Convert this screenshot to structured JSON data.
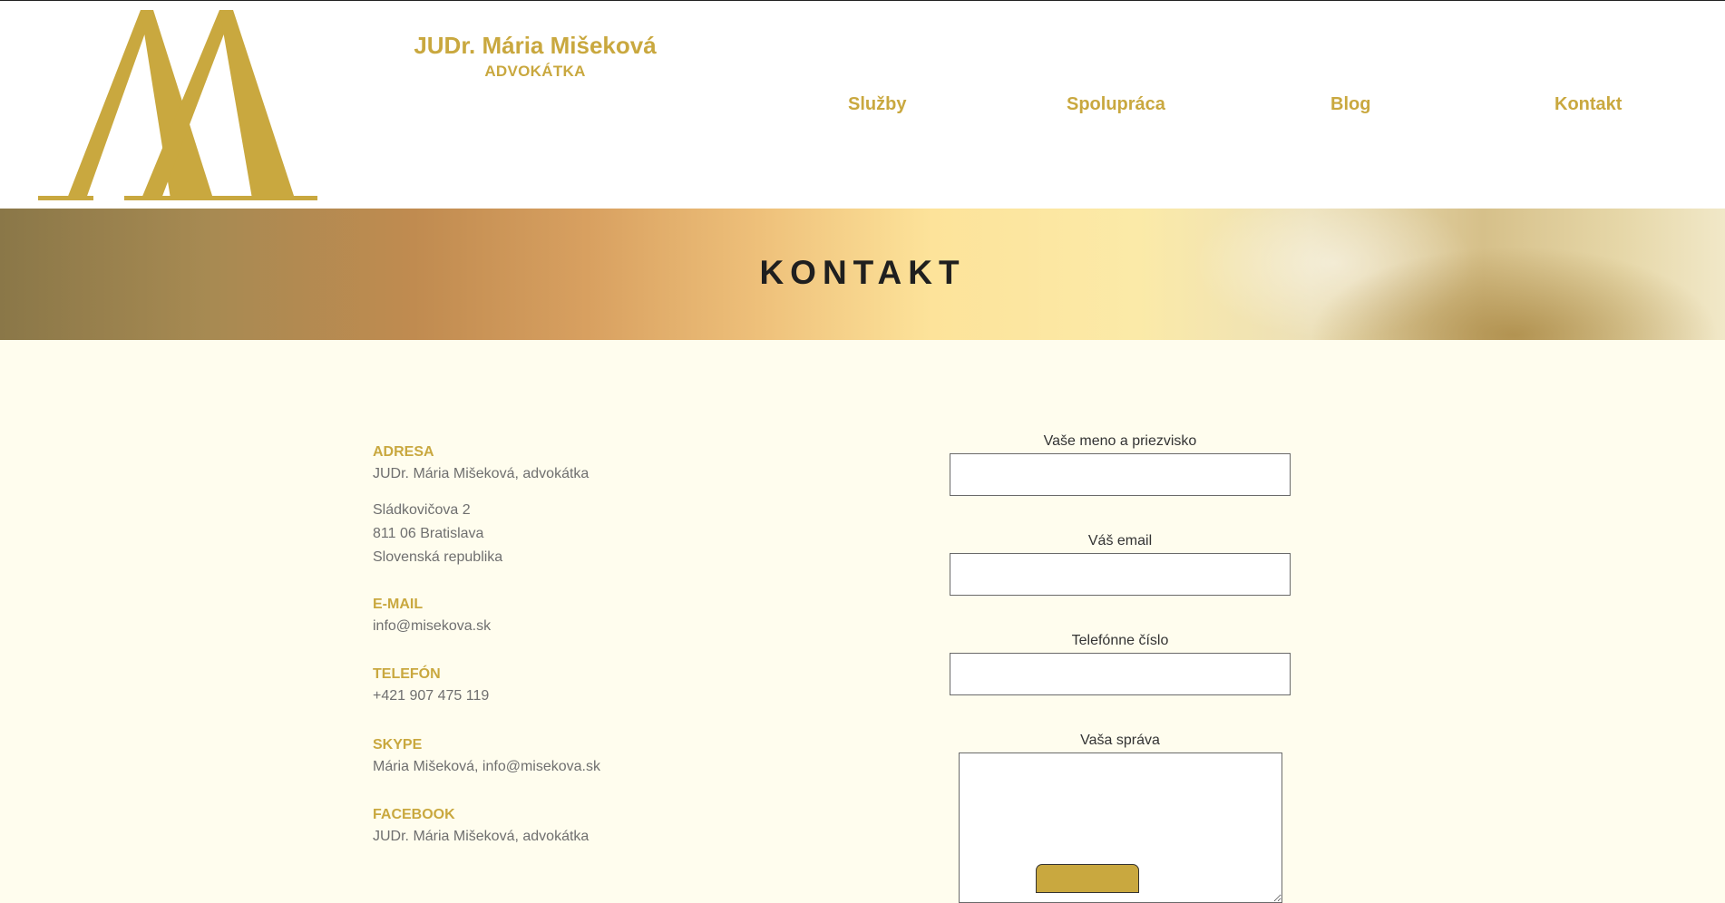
{
  "brand": {
    "name": "JUDr. Mária Mišeková",
    "subtitle": "ADVOKÁTKA",
    "logo_icon": "double-a-monogram-logo",
    "color": "#c9a83f"
  },
  "nav": {
    "items": [
      {
        "label": "Služby"
      },
      {
        "label": "Spolupráca"
      },
      {
        "label": "Blog"
      },
      {
        "label": "Kontakt"
      }
    ]
  },
  "banner": {
    "title": "KONTAKT"
  },
  "contact": {
    "address_label": "ADRESA",
    "address_name": "JUDr. Mária Mišeková, advokátka",
    "address_lines": [
      "Sládkovičova 2",
      "811 06 Bratislava",
      "Slovenská republika"
    ],
    "email_label": "E-MAIL",
    "email": "info@misekova.sk",
    "phone_label": "TELEFÓN",
    "phone": "+421 907 475 119",
    "skype_label": "SKYPE",
    "skype": "Mária Mišeková, info@misekova.sk",
    "facebook_label": "FACEBOOK",
    "facebook": "JUDr. Mária Mišeková, advokátka"
  },
  "form": {
    "name_label": "Vaše meno a priezvisko",
    "name_value": "",
    "email_label": "Váš email",
    "email_value": "",
    "phone_label": "Telefónne číslo",
    "phone_value": "",
    "message_label": "Vaša správa",
    "message_value": ""
  },
  "colors": {
    "accent": "#c9a83f",
    "page_background": "#fffdee",
    "heading": "#1f1f1f",
    "body_text": "#6f6f6f"
  }
}
